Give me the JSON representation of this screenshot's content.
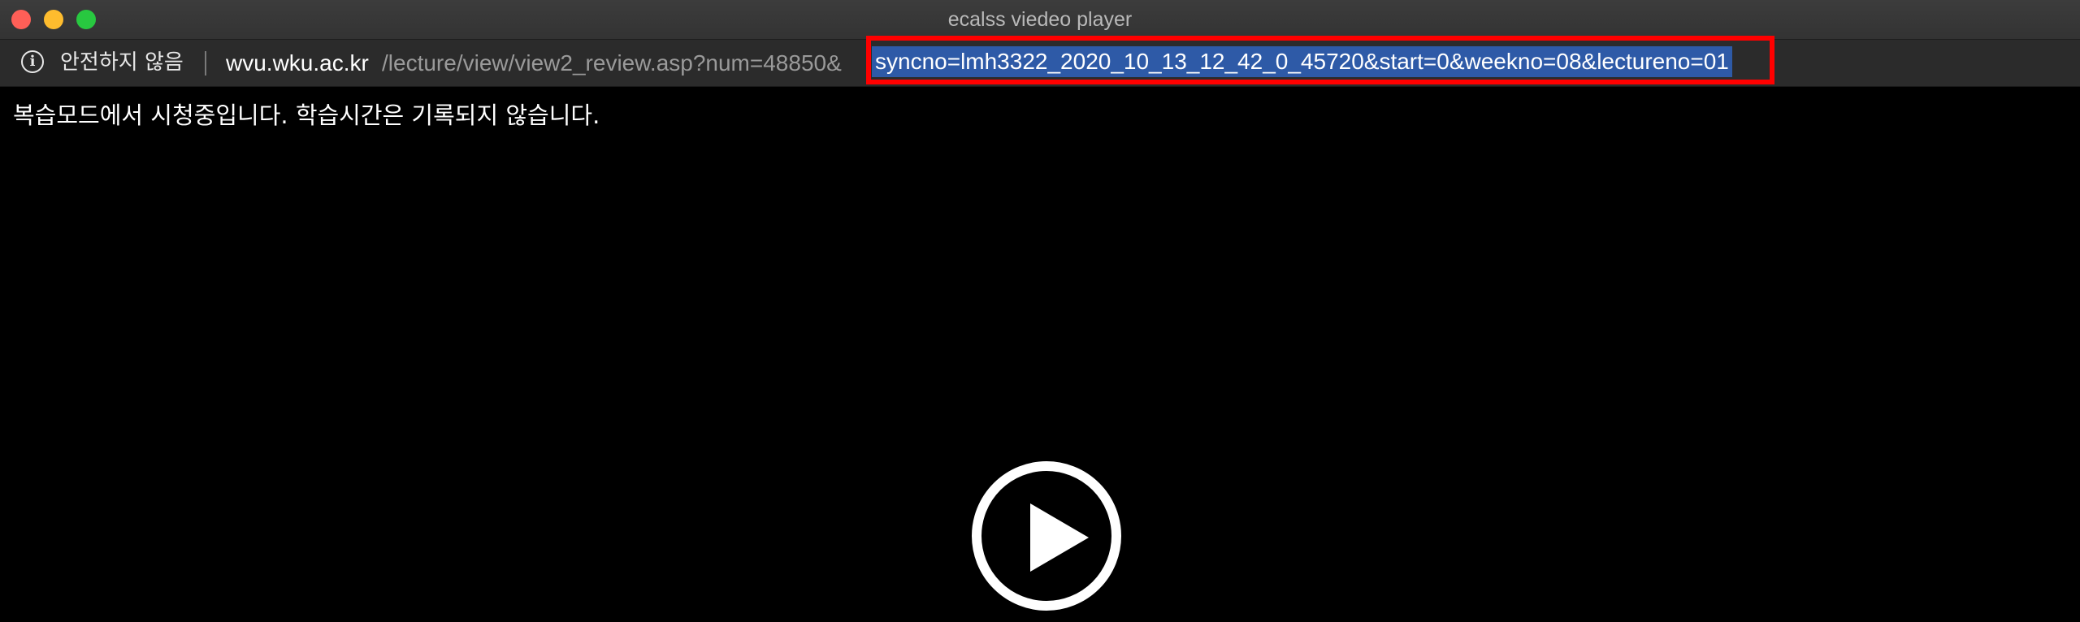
{
  "window": {
    "title": "ecalss viedeo player"
  },
  "address_bar": {
    "security_icon": "info-icon",
    "security_label": "안전하지 않음",
    "url_host": "wvu.wku.ac.kr",
    "url_path": "/lecture/view/view2_review.asp?num=48850&",
    "url_selected": "syncno=lmh3322_2020_10_13_12_42_0_45720&start=0&weekno=08&lectureno=01"
  },
  "content": {
    "notice": "복습모드에서 시청중입니다. 학습시간은 기록되지 않습니다.",
    "play_icon": "play-icon"
  },
  "colors": {
    "highlight_box": "#ff0000",
    "selection": "#2e5aa7",
    "background": "#000000"
  }
}
